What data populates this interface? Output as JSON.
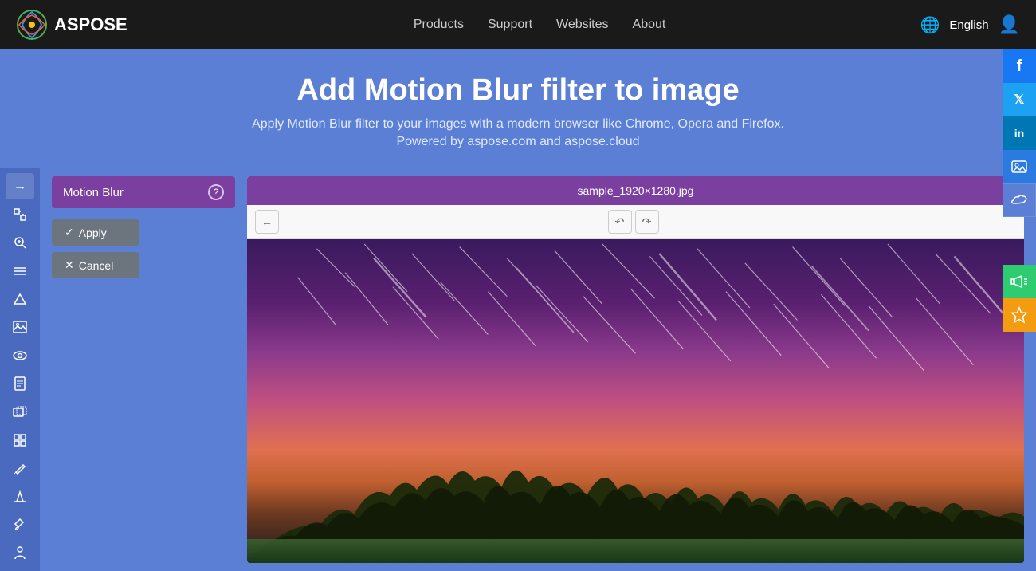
{
  "navbar": {
    "logo_text": "ASPOSE",
    "links": [
      {
        "label": "Products",
        "id": "products"
      },
      {
        "label": "Support",
        "id": "support"
      },
      {
        "label": "Websites",
        "id": "websites"
      },
      {
        "label": "About",
        "id": "about"
      }
    ],
    "language": "English",
    "language_icon": "🌐"
  },
  "hero": {
    "title": "Add Motion Blur filter to image",
    "description": "Apply Motion Blur filter to your images with a modern browser like Chrome, Opera and Firefox.",
    "powered_by": "Powered by aspose.com and aspose.cloud"
  },
  "filter_panel": {
    "title": "Motion Blur",
    "help_icon": "?",
    "apply_label": "✓ Apply",
    "cancel_label": "✕ Cancel"
  },
  "image_viewer": {
    "filename": "sample_1920×1280.jpg",
    "close_icon": "✕",
    "undo_icon": "↶",
    "redo_icon": "↷",
    "back_icon": "←"
  },
  "sidebar_icons": [
    {
      "id": "arrow-right",
      "icon": "→"
    },
    {
      "id": "transform",
      "icon": "⊞"
    },
    {
      "id": "zoom",
      "icon": "🔍"
    },
    {
      "id": "layers",
      "icon": "▤"
    },
    {
      "id": "mountain",
      "icon": "⛰"
    },
    {
      "id": "landscape",
      "icon": "🖼"
    },
    {
      "id": "eye",
      "icon": "👁"
    },
    {
      "id": "document",
      "icon": "📄"
    },
    {
      "id": "gallery",
      "icon": "🖼"
    },
    {
      "id": "grid",
      "icon": "⊞"
    },
    {
      "id": "pen",
      "icon": "✏"
    },
    {
      "id": "mountain2",
      "icon": "△"
    },
    {
      "id": "brush",
      "icon": "🖌"
    },
    {
      "id": "person",
      "icon": "👤"
    }
  ],
  "social": [
    {
      "id": "facebook",
      "icon": "f",
      "class": "social-fb"
    },
    {
      "id": "twitter",
      "icon": "t",
      "class": "social-tw"
    },
    {
      "id": "linkedin",
      "icon": "in",
      "class": "social-li"
    },
    {
      "id": "image-share",
      "icon": "🖼",
      "class": "social-img"
    },
    {
      "id": "cloud-share",
      "icon": "☁",
      "class": "social-cloud"
    }
  ],
  "colors": {
    "brand_purple": "#7b3fa0",
    "nav_bg": "#1a1a1a",
    "page_bg": "#5b7fd4",
    "btn_gray": "#6c757d"
  }
}
